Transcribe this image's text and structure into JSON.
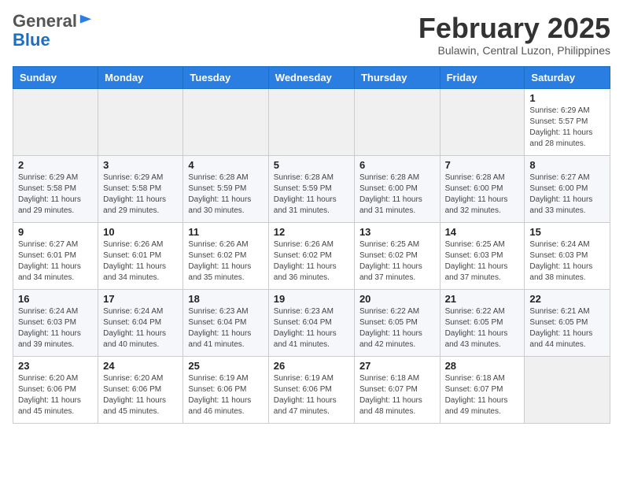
{
  "header": {
    "logo_general": "General",
    "logo_blue": "Blue",
    "month_title": "February 2025",
    "location": "Bulawin, Central Luzon, Philippines"
  },
  "columns": [
    "Sunday",
    "Monday",
    "Tuesday",
    "Wednesday",
    "Thursday",
    "Friday",
    "Saturday"
  ],
  "weeks": [
    [
      {
        "day": "",
        "info": ""
      },
      {
        "day": "",
        "info": ""
      },
      {
        "day": "",
        "info": ""
      },
      {
        "day": "",
        "info": ""
      },
      {
        "day": "",
        "info": ""
      },
      {
        "day": "",
        "info": ""
      },
      {
        "day": "1",
        "info": "Sunrise: 6:29 AM\nSunset: 5:57 PM\nDaylight: 11 hours and 28 minutes."
      }
    ],
    [
      {
        "day": "2",
        "info": "Sunrise: 6:29 AM\nSunset: 5:58 PM\nDaylight: 11 hours and 29 minutes."
      },
      {
        "day": "3",
        "info": "Sunrise: 6:29 AM\nSunset: 5:58 PM\nDaylight: 11 hours and 29 minutes."
      },
      {
        "day": "4",
        "info": "Sunrise: 6:28 AM\nSunset: 5:59 PM\nDaylight: 11 hours and 30 minutes."
      },
      {
        "day": "5",
        "info": "Sunrise: 6:28 AM\nSunset: 5:59 PM\nDaylight: 11 hours and 31 minutes."
      },
      {
        "day": "6",
        "info": "Sunrise: 6:28 AM\nSunset: 6:00 PM\nDaylight: 11 hours and 31 minutes."
      },
      {
        "day": "7",
        "info": "Sunrise: 6:28 AM\nSunset: 6:00 PM\nDaylight: 11 hours and 32 minutes."
      },
      {
        "day": "8",
        "info": "Sunrise: 6:27 AM\nSunset: 6:00 PM\nDaylight: 11 hours and 33 minutes."
      }
    ],
    [
      {
        "day": "9",
        "info": "Sunrise: 6:27 AM\nSunset: 6:01 PM\nDaylight: 11 hours and 34 minutes."
      },
      {
        "day": "10",
        "info": "Sunrise: 6:26 AM\nSunset: 6:01 PM\nDaylight: 11 hours and 34 minutes."
      },
      {
        "day": "11",
        "info": "Sunrise: 6:26 AM\nSunset: 6:02 PM\nDaylight: 11 hours and 35 minutes."
      },
      {
        "day": "12",
        "info": "Sunrise: 6:26 AM\nSunset: 6:02 PM\nDaylight: 11 hours and 36 minutes."
      },
      {
        "day": "13",
        "info": "Sunrise: 6:25 AM\nSunset: 6:02 PM\nDaylight: 11 hours and 37 minutes."
      },
      {
        "day": "14",
        "info": "Sunrise: 6:25 AM\nSunset: 6:03 PM\nDaylight: 11 hours and 37 minutes."
      },
      {
        "day": "15",
        "info": "Sunrise: 6:24 AM\nSunset: 6:03 PM\nDaylight: 11 hours and 38 minutes."
      }
    ],
    [
      {
        "day": "16",
        "info": "Sunrise: 6:24 AM\nSunset: 6:03 PM\nDaylight: 11 hours and 39 minutes."
      },
      {
        "day": "17",
        "info": "Sunrise: 6:24 AM\nSunset: 6:04 PM\nDaylight: 11 hours and 40 minutes."
      },
      {
        "day": "18",
        "info": "Sunrise: 6:23 AM\nSunset: 6:04 PM\nDaylight: 11 hours and 41 minutes."
      },
      {
        "day": "19",
        "info": "Sunrise: 6:23 AM\nSunset: 6:04 PM\nDaylight: 11 hours and 41 minutes."
      },
      {
        "day": "20",
        "info": "Sunrise: 6:22 AM\nSunset: 6:05 PM\nDaylight: 11 hours and 42 minutes."
      },
      {
        "day": "21",
        "info": "Sunrise: 6:22 AM\nSunset: 6:05 PM\nDaylight: 11 hours and 43 minutes."
      },
      {
        "day": "22",
        "info": "Sunrise: 6:21 AM\nSunset: 6:05 PM\nDaylight: 11 hours and 44 minutes."
      }
    ],
    [
      {
        "day": "23",
        "info": "Sunrise: 6:20 AM\nSunset: 6:06 PM\nDaylight: 11 hours and 45 minutes."
      },
      {
        "day": "24",
        "info": "Sunrise: 6:20 AM\nSunset: 6:06 PM\nDaylight: 11 hours and 45 minutes."
      },
      {
        "day": "25",
        "info": "Sunrise: 6:19 AM\nSunset: 6:06 PM\nDaylight: 11 hours and 46 minutes."
      },
      {
        "day": "26",
        "info": "Sunrise: 6:19 AM\nSunset: 6:06 PM\nDaylight: 11 hours and 47 minutes."
      },
      {
        "day": "27",
        "info": "Sunrise: 6:18 AM\nSunset: 6:07 PM\nDaylight: 11 hours and 48 minutes."
      },
      {
        "day": "28",
        "info": "Sunrise: 6:18 AM\nSunset: 6:07 PM\nDaylight: 11 hours and 49 minutes."
      },
      {
        "day": "",
        "info": ""
      }
    ]
  ]
}
